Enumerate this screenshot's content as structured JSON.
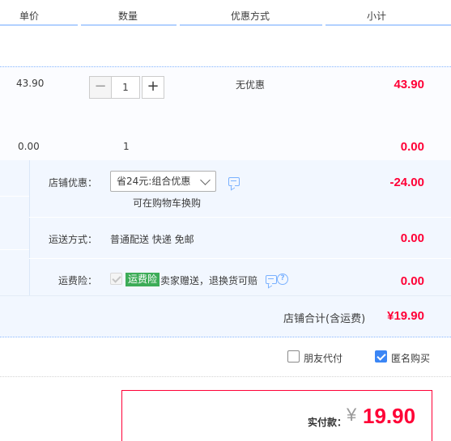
{
  "header": {
    "col_unit_price": "单价",
    "col_quantity": "数量",
    "col_discount": "优惠方式",
    "col_subtotal": "小计"
  },
  "item1": {
    "unit_price": "43.90",
    "quantity": "1",
    "discount": "无优惠",
    "subtotal": "43.90",
    "minus_label": "−",
    "plus_label": "+"
  },
  "item2": {
    "unit_price": "0.00",
    "quantity": "1",
    "subtotal": "0.00"
  },
  "shop_discount": {
    "label": "店铺优惠：",
    "selected": "省24元:组合优惠",
    "hint": "可在购物车换购",
    "amount": "-24.00"
  },
  "shipping": {
    "label": "运送方式：",
    "value": "普通配送 快递 免邮",
    "amount": "0.00"
  },
  "insurance": {
    "label": "运费险：",
    "badge": "运费险",
    "desc": "卖家赠送，退换货可赔",
    "amount": "0.00",
    "help": "?"
  },
  "shop_total": {
    "label": "店铺合计(含运费)",
    "amount": "¥19.90"
  },
  "options": {
    "friend_pay_label": "朋友代付",
    "friend_pay_checked": false,
    "anonymous_label": "匿名购买",
    "anonymous_checked": true
  },
  "payment": {
    "label": "实付款：",
    "currency": "¥",
    "amount": "19.90"
  },
  "colors": {
    "accent_red": "#ff0036",
    "accent_blue": "#3b86f5",
    "badge_green": "#3dac58",
    "panel_bg": "#f2f7ff"
  }
}
